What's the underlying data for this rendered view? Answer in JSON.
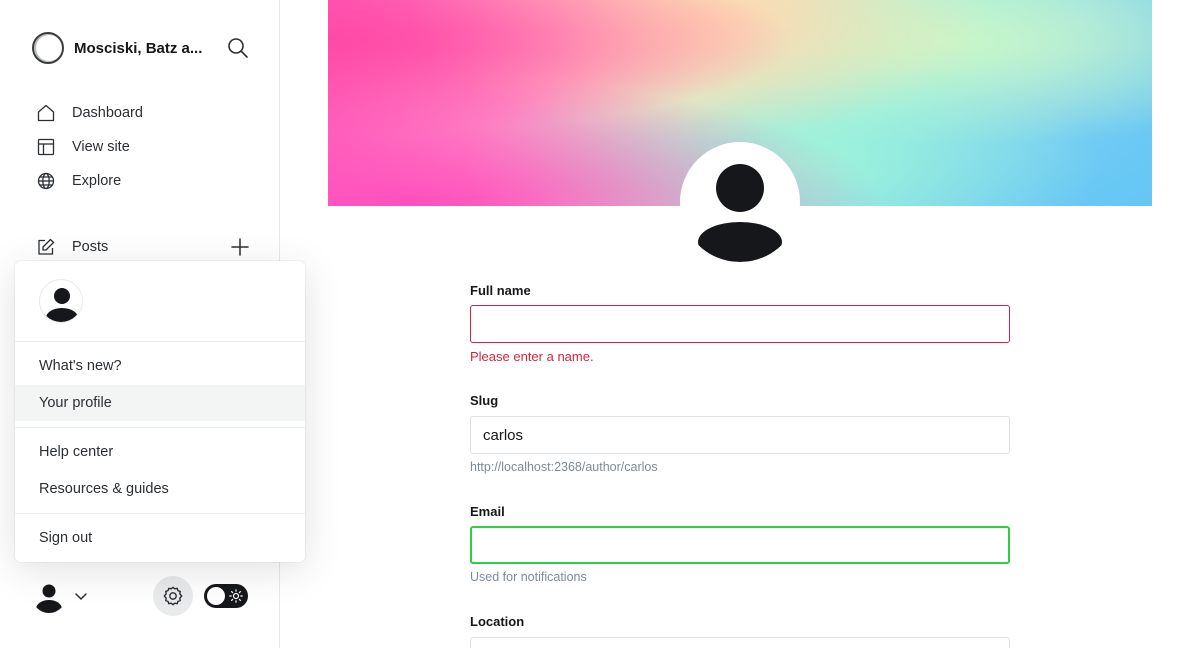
{
  "sidebar": {
    "site_title": "Mosciski, Batz a...",
    "nav": [
      {
        "label": "Dashboard",
        "icon": "home-icon"
      },
      {
        "label": "View site",
        "icon": "layout-icon"
      },
      {
        "label": "Explore",
        "icon": "globe-icon"
      }
    ],
    "posts_label": "Posts"
  },
  "user_menu": {
    "items": {
      "whats_new": "What's new?",
      "your_profile": "Your profile",
      "help_center": "Help center",
      "resources": "Resources & guides",
      "sign_out": "Sign out"
    },
    "active_item": "your_profile"
  },
  "profile_form": {
    "full_name": {
      "label": "Full name",
      "value": "",
      "error": "Please enter a name."
    },
    "slug": {
      "label": "Slug",
      "value": "carlos",
      "hint": "http://localhost:2368/author/carlos"
    },
    "email": {
      "label": "Email",
      "value": "",
      "hint": "Used for notifications"
    },
    "location": {
      "label": "Location",
      "value": ""
    }
  },
  "colors": {
    "error": "#d7243f",
    "focus": "#30cf43",
    "dark": "#15171a"
  },
  "theme_toggle": {
    "state": "dark",
    "icon": "sun-icon"
  }
}
